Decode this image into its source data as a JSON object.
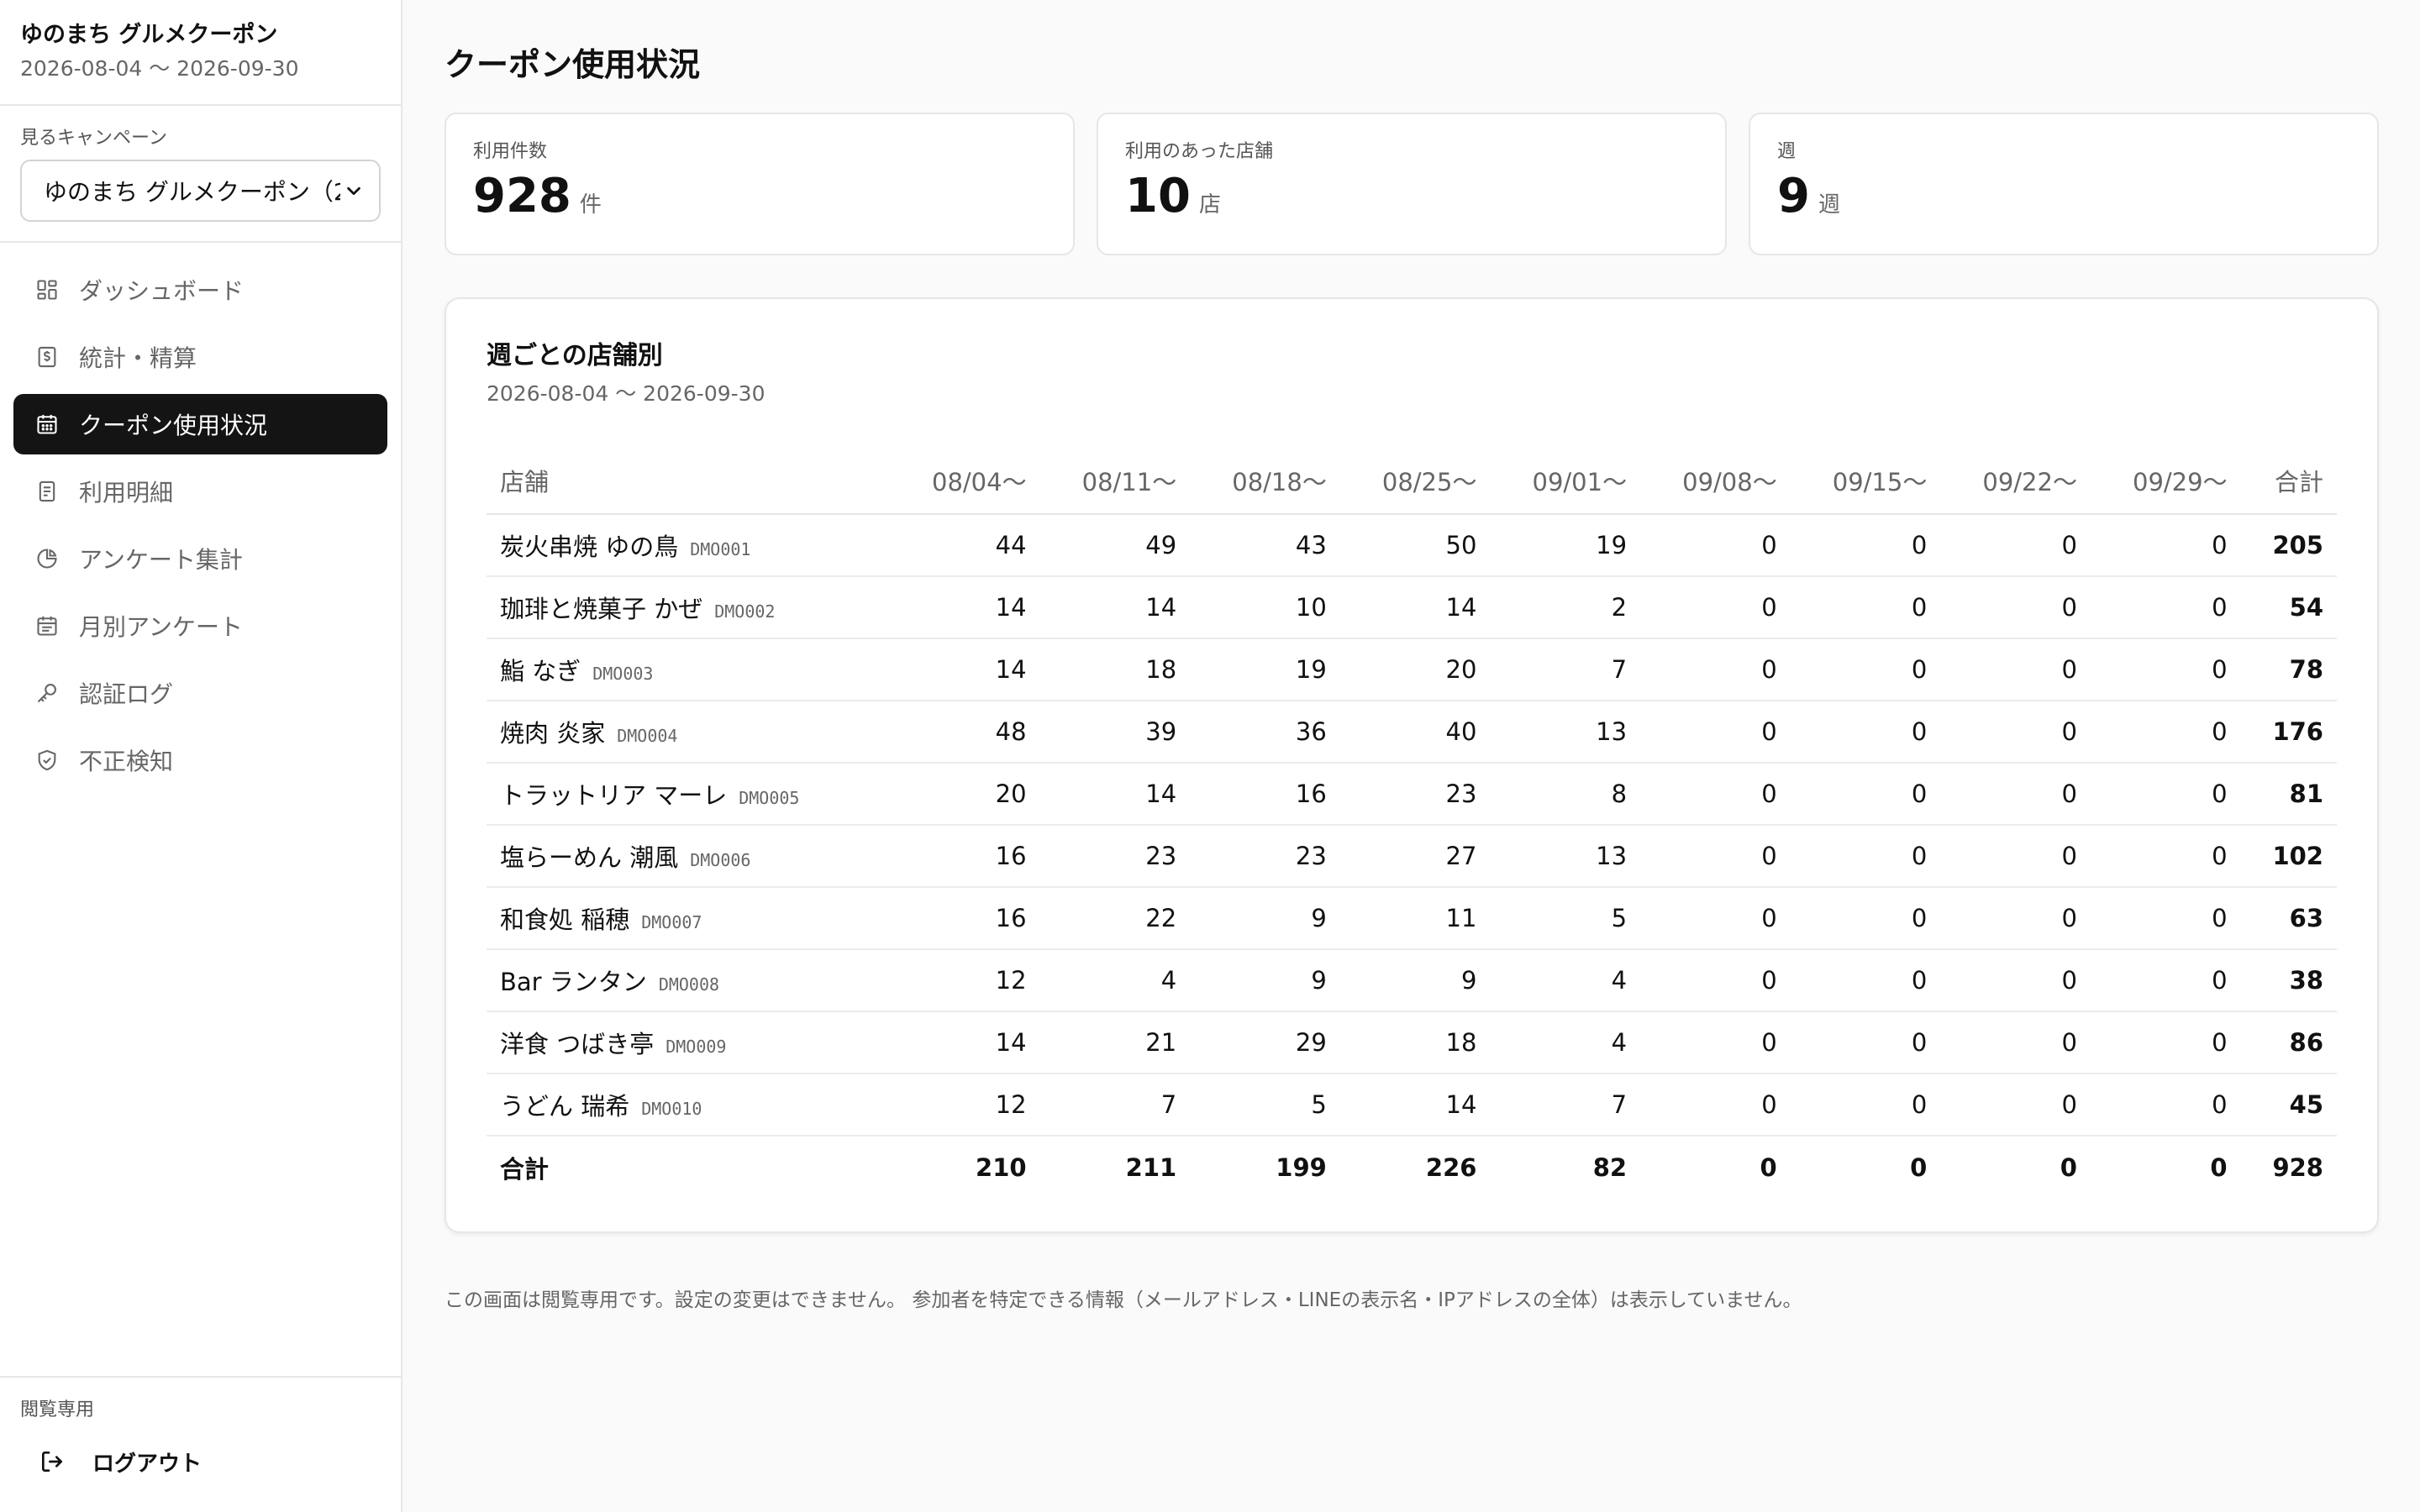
{
  "sidebar": {
    "title": "ゆのまち グルメクーポン",
    "period": "2026-08-04 〜 2026-09-30",
    "campaign_label": "見るキャンペーン",
    "campaign_value": "ゆのまち グルメクーポン（2",
    "nav": [
      {
        "label": "ダッシュボード",
        "icon": "grid-icon"
      },
      {
        "label": "統計・精算",
        "icon": "receipt-dollar-icon"
      },
      {
        "label": "クーポン使用状況",
        "icon": "calendar-icon",
        "active": true
      },
      {
        "label": "利用明細",
        "icon": "document-icon"
      },
      {
        "label": "アンケート集計",
        "icon": "pie-chart-icon"
      },
      {
        "label": "月別アンケート",
        "icon": "calendar-list-icon"
      },
      {
        "label": "認証ログ",
        "icon": "key-icon"
      },
      {
        "label": "不正検知",
        "icon": "shield-check-icon"
      }
    ],
    "footer_label": "閲覧専用",
    "logout_label": "ログアウト"
  },
  "main": {
    "title": "クーポン使用状況",
    "stats": [
      {
        "label": "利用件数",
        "value": "928",
        "unit": "件"
      },
      {
        "label": "利用のあった店舗",
        "value": "10",
        "unit": "店"
      },
      {
        "label": "週",
        "value": "9",
        "unit": "週"
      }
    ],
    "table_card": {
      "title": "週ごとの店舗別",
      "period": "2026-08-04 〜 2026-09-30",
      "columns": [
        "店舗",
        "08/04〜",
        "08/11〜",
        "08/18〜",
        "08/25〜",
        "09/01〜",
        "09/08〜",
        "09/15〜",
        "09/22〜",
        "09/29〜",
        "合計"
      ],
      "rows": [
        {
          "name": "炭火串焼 ゆの鳥",
          "code": "DMO001",
          "values": [
            44,
            49,
            43,
            50,
            19,
            0,
            0,
            0,
            0
          ],
          "total": 205
        },
        {
          "name": "珈琲と焼菓子 かぜ",
          "code": "DMO002",
          "values": [
            14,
            14,
            10,
            14,
            2,
            0,
            0,
            0,
            0
          ],
          "total": 54
        },
        {
          "name": "鮨 なぎ",
          "code": "DMO003",
          "values": [
            14,
            18,
            19,
            20,
            7,
            0,
            0,
            0,
            0
          ],
          "total": 78
        },
        {
          "name": "焼肉 炎家",
          "code": "DMO004",
          "values": [
            48,
            39,
            36,
            40,
            13,
            0,
            0,
            0,
            0
          ],
          "total": 176
        },
        {
          "name": "トラットリア マーレ",
          "code": "DMO005",
          "values": [
            20,
            14,
            16,
            23,
            8,
            0,
            0,
            0,
            0
          ],
          "total": 81
        },
        {
          "name": "塩らーめん 潮風",
          "code": "DMO006",
          "values": [
            16,
            23,
            23,
            27,
            13,
            0,
            0,
            0,
            0
          ],
          "total": 102
        },
        {
          "name": "和食処 稲穂",
          "code": "DMO007",
          "values": [
            16,
            22,
            9,
            11,
            5,
            0,
            0,
            0,
            0
          ],
          "total": 63
        },
        {
          "name": "Bar ランタン",
          "code": "DMO008",
          "values": [
            12,
            4,
            9,
            9,
            4,
            0,
            0,
            0,
            0
          ],
          "total": 38
        },
        {
          "name": "洋食 つばき亭",
          "code": "DMO009",
          "values": [
            14,
            21,
            29,
            18,
            4,
            0,
            0,
            0,
            0
          ],
          "total": 86
        },
        {
          "name": "うどん 瑞希",
          "code": "DMO010",
          "values": [
            12,
            7,
            5,
            14,
            7,
            0,
            0,
            0,
            0
          ],
          "total": 45
        }
      ],
      "sum_row": {
        "label": "合計",
        "values": [
          210,
          211,
          199,
          226,
          82,
          0,
          0,
          0,
          0
        ],
        "total": 928
      }
    },
    "footnote": "この画面は閲覧専用です。設定の変更はできません。 参加者を特定できる情報（メールアドレス・LINEの表示名・IPアドレスの全体）は表示していません。"
  }
}
